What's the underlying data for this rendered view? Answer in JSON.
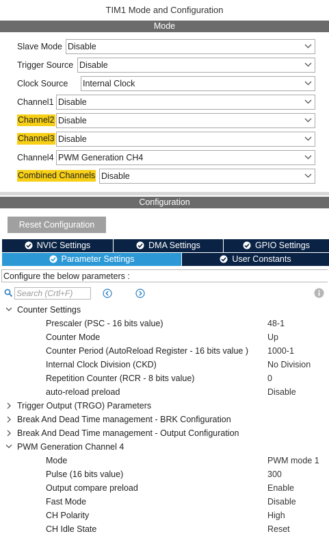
{
  "window": {
    "title": "TIM1 Mode and Configuration"
  },
  "mode_header": "Mode",
  "mode_fields": [
    {
      "label": "Slave Mode",
      "value": "Disable",
      "highlight": false
    },
    {
      "label": "Trigger Source",
      "value": "Disable",
      "highlight": false
    },
    {
      "label": "Clock Source",
      "value": "Internal Clock",
      "highlight": false
    },
    {
      "label": "Channel1",
      "value": "Disable",
      "highlight": false
    },
    {
      "label": "Channel2",
      "value": "Disable",
      "highlight": true
    },
    {
      "label": "Channel3",
      "value": "Disable",
      "highlight": true
    },
    {
      "label": "Channel4",
      "value": "PWM Generation CH4",
      "highlight": false
    },
    {
      "label": "Combined Channels",
      "value": "Disable",
      "highlight": true
    }
  ],
  "config_header": "Configuration",
  "reset_button": "Reset Configuration",
  "tabs_row1": [
    {
      "label": "NVIC Settings"
    },
    {
      "label": "DMA Settings"
    },
    {
      "label": "GPIO Settings"
    }
  ],
  "tabs_row2": [
    {
      "label": "Parameter Settings",
      "active": true
    },
    {
      "label": "User Constants",
      "active": false
    }
  ],
  "description": "Configure the below parameters :",
  "search": {
    "placeholder": "Search (Crtl+F)"
  },
  "tree": {
    "counter": {
      "title": "Counter Settings",
      "params": [
        {
          "name": "Prescaler (PSC - 16 bits value)",
          "value": "48-1"
        },
        {
          "name": "Counter Mode",
          "value": "Up"
        },
        {
          "name": "Counter Period (AutoReload Register - 16 bits value )",
          "value": "1000-1"
        },
        {
          "name": "Internal Clock Division (CKD)",
          "value": "No Division"
        },
        {
          "name": "Repetition Counter (RCR - 8 bits value)",
          "value": "0"
        },
        {
          "name": "auto-reload preload",
          "value": "Disable"
        }
      ]
    },
    "collapsed": [
      "Trigger Output (TRGO) Parameters",
      "Break And Dead Time management - BRK Configuration",
      "Break And Dead Time management - Output Configuration"
    ],
    "pwm": {
      "title": "PWM Generation Channel 4",
      "params": [
        {
          "name": "Mode",
          "value": "PWM mode 1"
        },
        {
          "name": "Pulse (16 bits value)",
          "value": "300"
        },
        {
          "name": "Output compare preload",
          "value": "Enable"
        },
        {
          "name": "Fast Mode",
          "value": "Disable"
        },
        {
          "name": "CH Polarity",
          "value": "High"
        },
        {
          "name": "CH Idle State",
          "value": "Reset"
        }
      ]
    }
  },
  "colors": {
    "header_bar": "#6b6b6b",
    "tab_dark": "#0a2345",
    "tab_active": "#2c99d6",
    "highlight": "#f7cf17",
    "icon_blue": "#2a7fc2"
  },
  "icons": [
    "chevron-down-icon",
    "check-circle-icon",
    "search-icon",
    "arrow-left-circle-icon",
    "arrow-right-circle-icon",
    "info-icon",
    "expand-icon",
    "collapse-icon"
  ]
}
